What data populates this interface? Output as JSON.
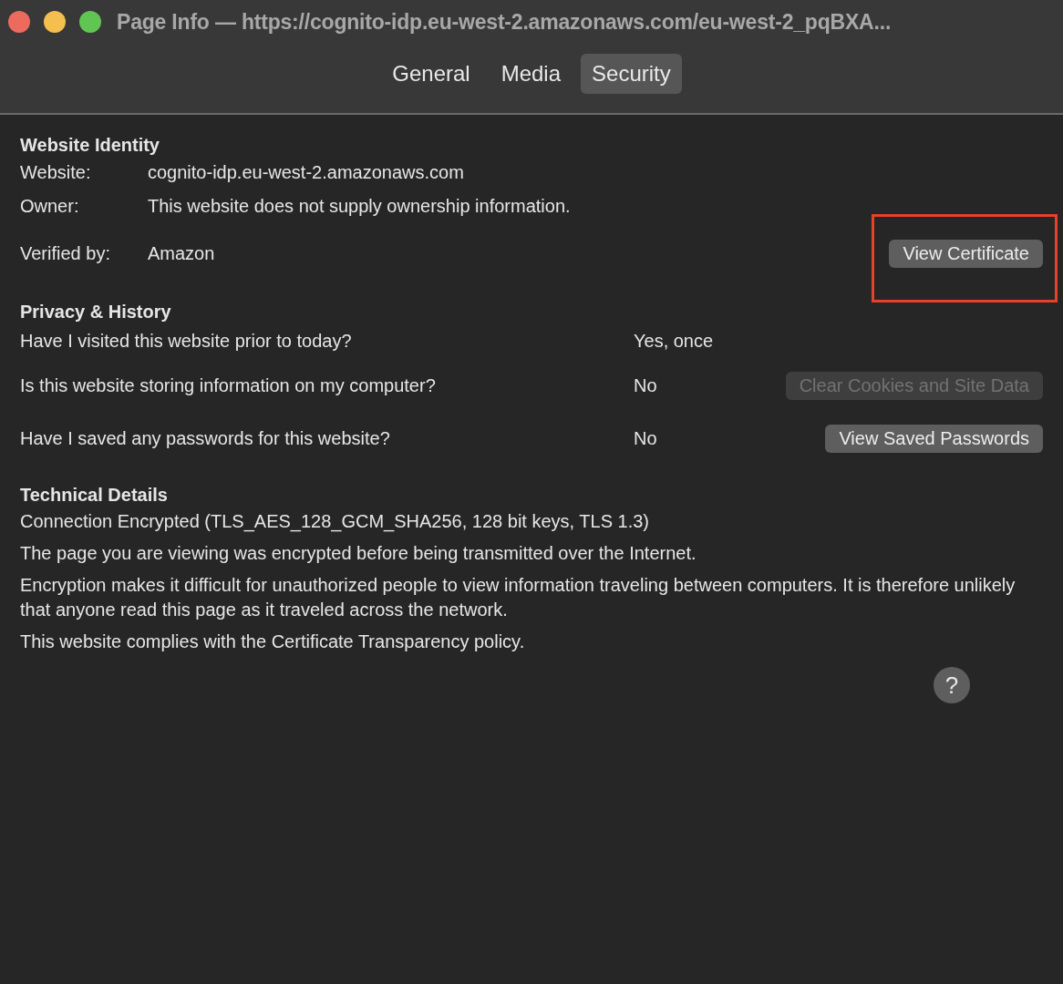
{
  "window": {
    "title": "Page Info — https://cognito-idp.eu-west-2.amazonaws.com/eu-west-2_pqBXA..."
  },
  "tabs": [
    {
      "label": "General",
      "selected": false
    },
    {
      "label": "Media",
      "selected": false
    },
    {
      "label": "Security",
      "selected": true
    }
  ],
  "website_identity": {
    "heading": "Website Identity",
    "rows": [
      {
        "label": "Website:",
        "value": "cognito-idp.eu-west-2.amazonaws.com"
      },
      {
        "label": "Owner:",
        "value": "This website does not supply ownership information."
      },
      {
        "label": "Verified by:",
        "value": "Amazon",
        "button": {
          "label": "View Certificate",
          "disabled": false,
          "highlighted": true
        }
      }
    ]
  },
  "privacy": {
    "heading": "Privacy & History",
    "rows": [
      {
        "question": "Have I visited this website prior to today?",
        "answer": "Yes, once"
      },
      {
        "question": "Is this website storing information on my computer?",
        "answer": "No",
        "button": {
          "label": "Clear Cookies and Site Data",
          "disabled": true,
          "highlighted": false
        }
      },
      {
        "question": "Have I saved any passwords for this website?",
        "answer": "No",
        "button": {
          "label": "View Saved Passwords",
          "disabled": false,
          "highlighted": false
        }
      }
    ]
  },
  "technical": {
    "heading": "Technical Details",
    "paragraphs": [
      "Connection Encrypted (TLS_AES_128_GCM_SHA256, 128 bit keys, TLS 1.3)",
      "The page you are viewing was encrypted before being transmitted over the Internet.",
      "Encryption makes it difficult for unauthorized people to view information traveling between computers. It is therefore unlikely that anyone read this page as it traveled across the network.",
      "This website complies with the Certificate Transparency policy."
    ]
  },
  "help_button": {
    "label": "?"
  }
}
